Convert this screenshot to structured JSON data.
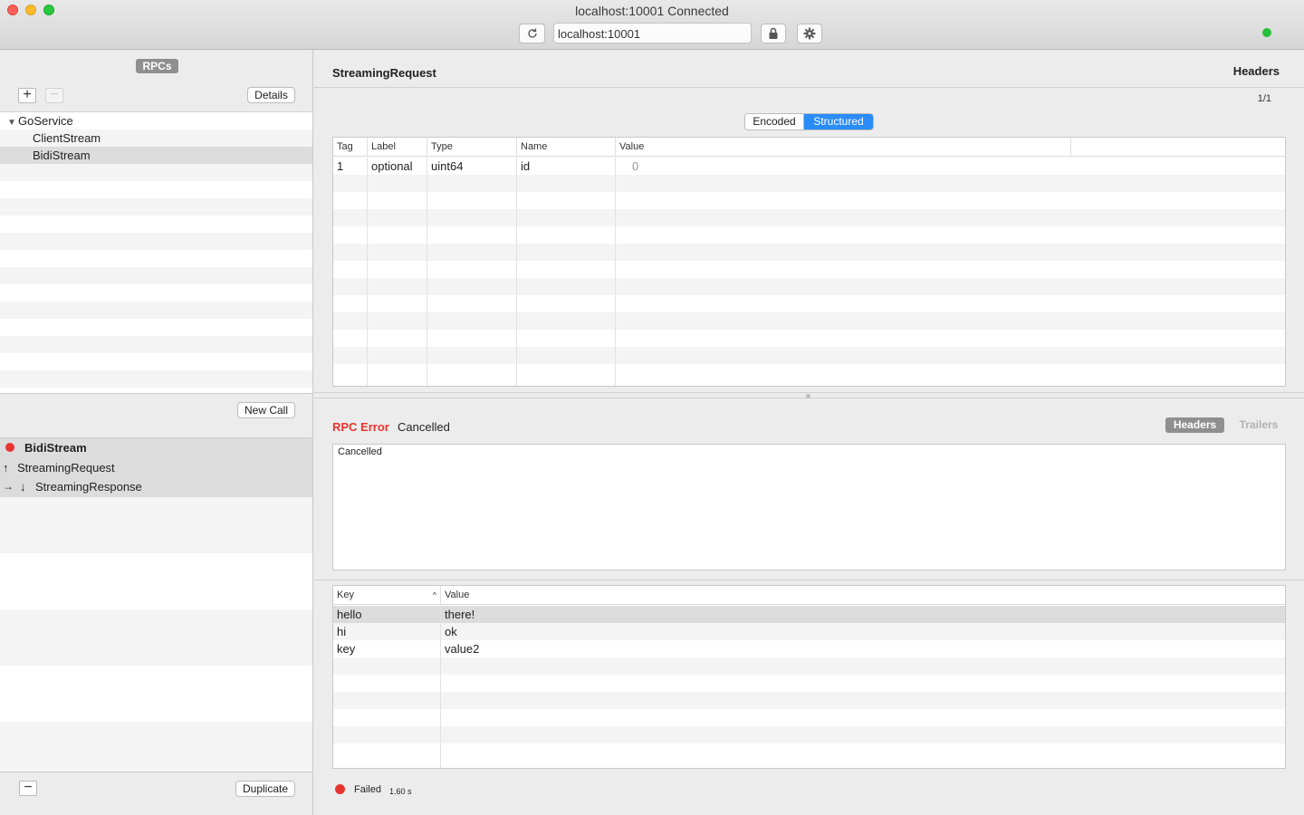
{
  "window": {
    "title": "localhost:10001 Connected",
    "url": "localhost:10001",
    "connection_color": "#25c13b"
  },
  "sidebar": {
    "badge": "RPCs",
    "details_label": "Details",
    "tree": [
      {
        "label": "GoService",
        "type": "group"
      },
      {
        "label": "ClientStream",
        "type": "method"
      },
      {
        "label": "BidiStream",
        "type": "method",
        "selected": true
      }
    ],
    "new_call_label": "New Call",
    "calls": [
      {
        "label": "BidiStream",
        "status": "failed"
      },
      {
        "label": "StreamingRequest",
        "direction": "up"
      },
      {
        "label": "StreamingResponse",
        "direction": "down",
        "current": true
      }
    ],
    "duplicate_label": "Duplicate"
  },
  "message": {
    "title": "StreamingRequest",
    "headers_link": "Headers",
    "page_indicator": "1/1",
    "segments": [
      "Encoded",
      "Structured"
    ],
    "active_segment": "Structured",
    "columns": [
      "Tag",
      "Label",
      "Type",
      "Name",
      "Value"
    ],
    "rows": [
      {
        "tag": "1",
        "label": "optional",
        "type": "uint64",
        "name": "id",
        "value": "0"
      }
    ]
  },
  "result": {
    "error_label": "RPC Error",
    "error_status": "Cancelled",
    "tabs": [
      "Headers",
      "Trailers"
    ],
    "active_tab": "Headers",
    "error_detail": "Cancelled",
    "kv_columns": [
      "Key",
      "Value"
    ],
    "kv_rows": [
      {
        "key": "hello",
        "value": "there!"
      },
      {
        "key": "hi",
        "value": "ok"
      },
      {
        "key": "key",
        "value": "value2"
      }
    ]
  },
  "status": {
    "text": "Failed",
    "time": "1.60 s",
    "color": "#e8342f"
  }
}
